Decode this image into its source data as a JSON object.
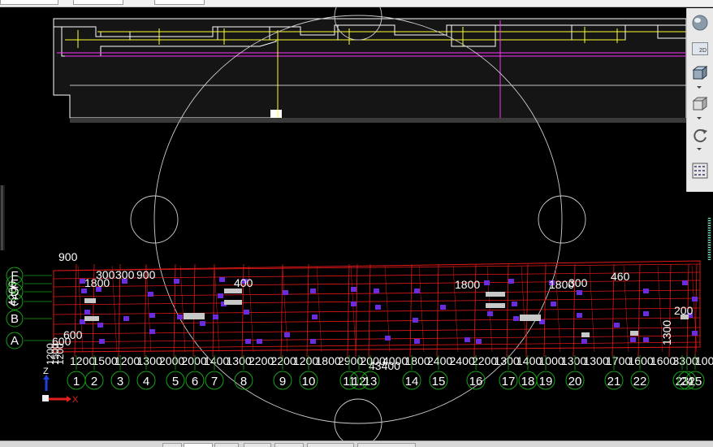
{
  "toolbar_top": {
    "fields": [
      "",
      "",
      ""
    ]
  },
  "view_toolbar": {
    "buttons": [
      {
        "name": "view-sphere-icon"
      },
      {
        "name": "2d-view-button",
        "label": "2D"
      },
      {
        "name": "3d-box-icon"
      },
      {
        "name": "box-icon"
      },
      {
        "name": "rotate-icon"
      },
      {
        "name": "properties-grid-icon"
      }
    ]
  },
  "drawing": {
    "axis_numbers": [
      "1",
      "2",
      "3",
      "4",
      "5",
      "6",
      "7",
      "8",
      "9",
      "10",
      "11",
      "12",
      "13",
      "14",
      "15",
      "16",
      "17",
      "18",
      "19",
      "20",
      "21",
      "22",
      "23",
      "24",
      "25"
    ],
    "row_labels": [
      "A",
      "B",
      "C",
      "D",
      "E",
      "F"
    ],
    "dim_labels": [
      "900",
      "300",
      "300",
      "900",
      "1800",
      "1800",
      "460",
      "600",
      "400",
      "4200",
      "43400",
      "1300",
      "1800",
      "300",
      "600",
      "200"
    ],
    "bottom_dim_text": [
      "1200",
      "1500",
      "1200",
      "1300",
      "2000",
      "2000",
      "1400",
      "1300",
      "2200",
      "2200",
      "1200",
      "1800",
      "2900",
      "2000",
      "4000",
      "1800",
      "2400",
      "2400",
      "2200",
      "1300",
      "1400",
      "1000",
      "1300",
      "1300",
      "1700",
      "1600",
      "1600",
      "3300",
      "1000"
    ],
    "ucs": {
      "z": "Z",
      "x": "X"
    }
  },
  "bottom_tabs": [
    "",
    "",
    "",
    "",
    "",
    "",
    "",
    "",
    ""
  ],
  "colors": {
    "background": "#000000",
    "grid": "#e01818",
    "outline": "#ffffff",
    "magenta": "#ff33ff",
    "yellow": "#ffff33",
    "purple": "#6b2ce0",
    "axis_bubble": "#15a315",
    "ucs_x": "#e02020",
    "ucs_z": "#2040e0"
  }
}
